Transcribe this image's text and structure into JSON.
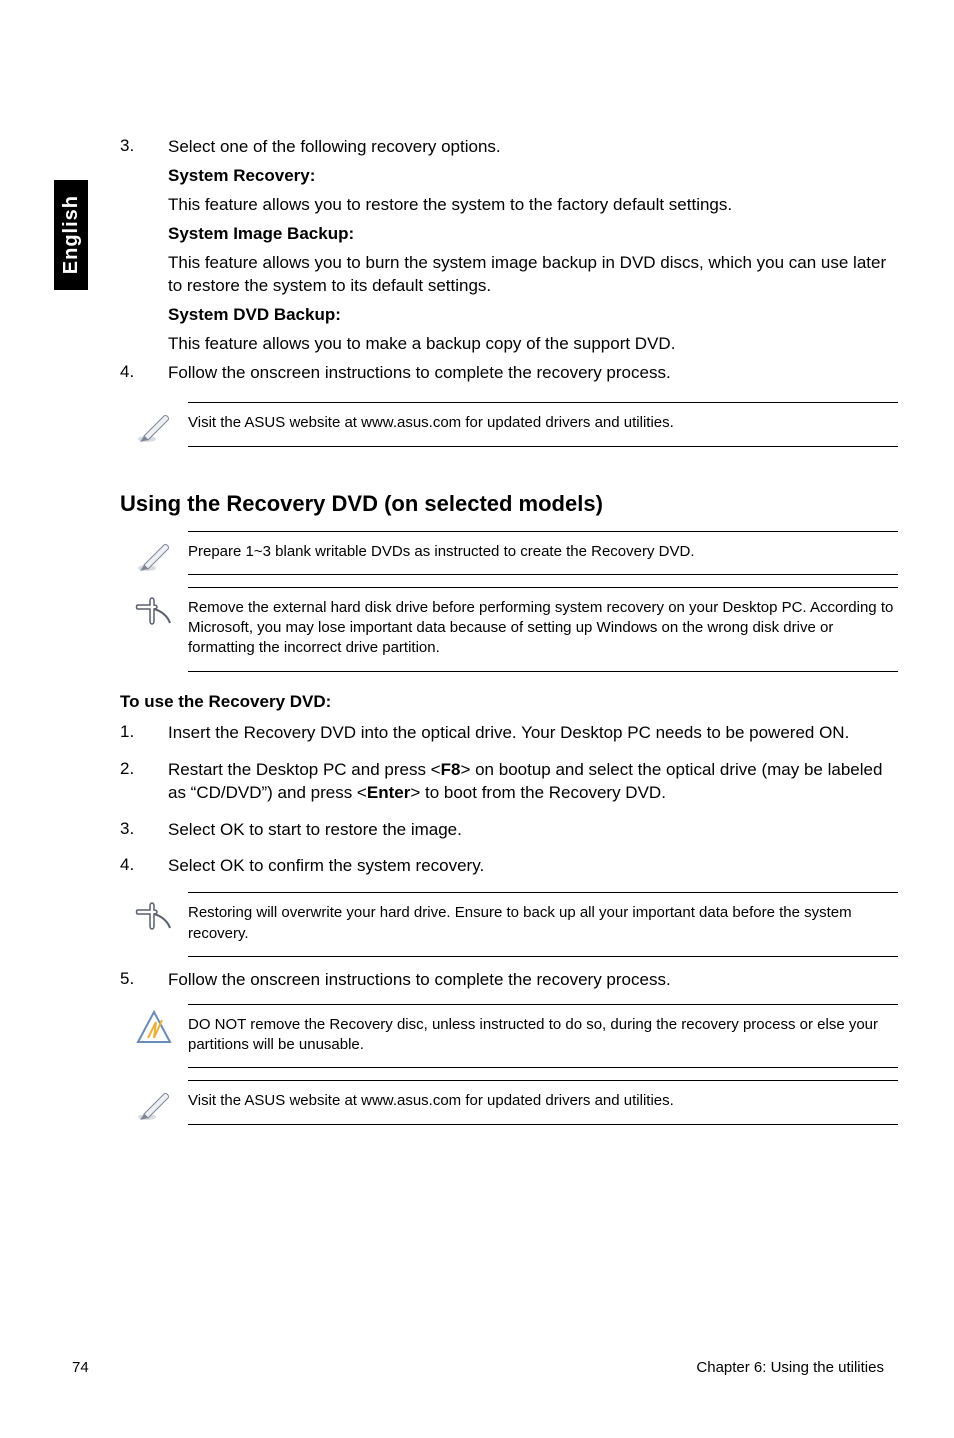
{
  "side_tab": "English",
  "step3_lead": "Select one of the following recovery options.",
  "system_recovery_title": "System Recovery:",
  "system_recovery_body": "This feature allows you to restore the system to the factory default settings.",
  "system_image_title": "System Image Backup:",
  "system_image_body": "This feature allows you to burn the system image backup in DVD discs, which you can use later to restore the system to its default settings.",
  "system_dvd_title": "System DVD Backup:",
  "system_dvd_body": "This feature allows you to make a backup copy of the support DVD.",
  "step4": "Follow the onscreen instructions to complete the recovery process.",
  "note_visit": "Visit the ASUS website at www.asus.com for updated drivers and utilities.",
  "heading_recovery_dvd": "Using the Recovery DVD (on selected models)",
  "note_prepare": "Prepare 1~3 blank writable DVDs as instructed to create the Recovery DVD.",
  "note_remove_hdd": "Remove the external hard disk drive before performing system recovery on your Desktop PC. According to Microsoft, you may lose important data because of setting up Windows on the wrong disk drive or formatting the incorrect drive partition.",
  "to_use_title": "To use the Recovery DVD:",
  "use1": "Insert the Recovery DVD into the optical drive. Your Desktop PC needs to be powered ON.",
  "use2_a": "Restart the Desktop PC and press <",
  "use2_k1": "F8",
  "use2_b": "> on bootup and select the optical drive (may be labeled as “CD/DVD”) and press <",
  "use2_k2": "Enter",
  "use2_c": "> to boot from the Recovery DVD.",
  "use3": "Select OK to start to restore the image.",
  "use4": "Select OK to confirm the system recovery.",
  "note_restoring": "Restoring will overwrite your hard drive. Ensure to back up all your important data before the system recovery.",
  "step5": "Follow the onscreen instructions to complete the recovery process.",
  "note_donot": "DO NOT remove the Recovery disc, unless instructed to do so, during the recovery process or else your partitions will be unusable.",
  "note_visit2": "Visit the ASUS website at www.asus.com for updated drivers and utilities.",
  "page_number": "74",
  "chapter_footer": "Chapter 6: Using the utilities",
  "numbers": {
    "n3": "3.",
    "n4": "4.",
    "u1": "1.",
    "u2": "2.",
    "u3": "3.",
    "u4": "4.",
    "u5": "5."
  }
}
